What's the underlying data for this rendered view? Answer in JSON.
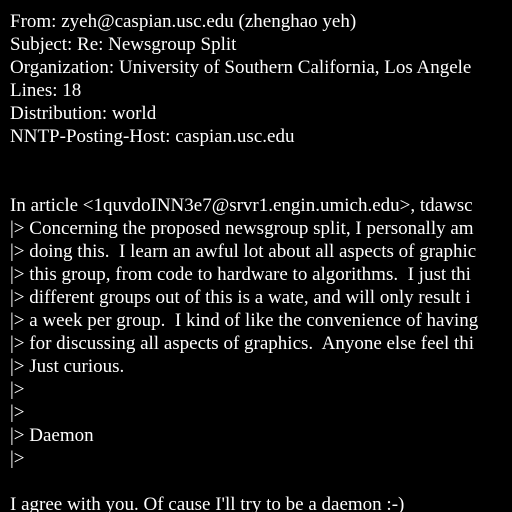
{
  "colors": {
    "background": "#000000",
    "text": "#ffffff"
  },
  "headers": {
    "from": "From: zyeh@caspian.usc.edu (zhenghao yeh)",
    "subject": "Subject: Re: Newsgroup Split",
    "organization": "Organization: University of Southern California, Los Angele",
    "lines": "Lines: 18",
    "distribution": "Distribution: world",
    "nntp_posting_host": "NNTP-Posting-Host: caspian.usc.edu"
  },
  "body": {
    "attribution": "In article <1quvdoINN3e7@srvr1.engin.umich.edu>, tdawsc",
    "quoted_lines": [
      "|> Concerning the proposed newsgroup split, I personally am",
      "|> doing this.  I learn an awful lot about all aspects of graphic",
      "|> this group, from code to hardware to algorithms.  I just thi",
      "|> different groups out of this is a wate, and will only result i",
      "|> a week per group.  I kind of like the convenience of having",
      "|> for discussing all aspects of graphics.  Anyone else feel thi",
      "|> Just curious.",
      "|>",
      "|>",
      "|> Daemon",
      "|>"
    ],
    "reply": "I agree with you. Of cause I'll try to be a daemon :-)"
  }
}
